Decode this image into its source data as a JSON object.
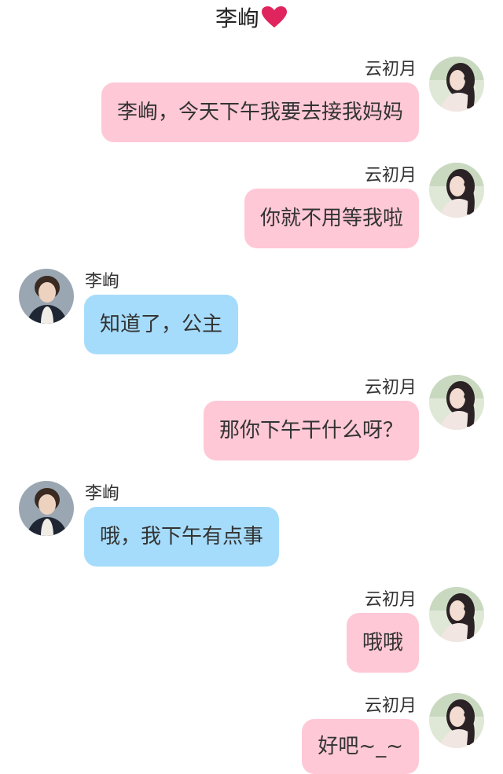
{
  "header": {
    "title": "李峋",
    "title_icon": "red-heart-icon"
  },
  "colors": {
    "outgoing_bubble": "#ffc8d6",
    "incoming_bubble": "#a6dcfb",
    "heart": "#e0245e"
  },
  "messages": [
    {
      "side": "right",
      "sender": "云初月",
      "text": "李峋，今天下午我要去接我妈妈"
    },
    {
      "side": "right",
      "sender": "云初月",
      "text": "你就不用等我啦"
    },
    {
      "side": "left",
      "sender": "李峋",
      "text": "知道了，公主"
    },
    {
      "side": "right",
      "sender": "云初月",
      "text": "那你下午干什么呀？"
    },
    {
      "side": "left",
      "sender": "李峋",
      "text": "哦，我下午有点事"
    },
    {
      "side": "right",
      "sender": "云初月",
      "text": "哦哦"
    },
    {
      "side": "right",
      "sender": "云初月",
      "text": "好吧~_~"
    }
  ]
}
